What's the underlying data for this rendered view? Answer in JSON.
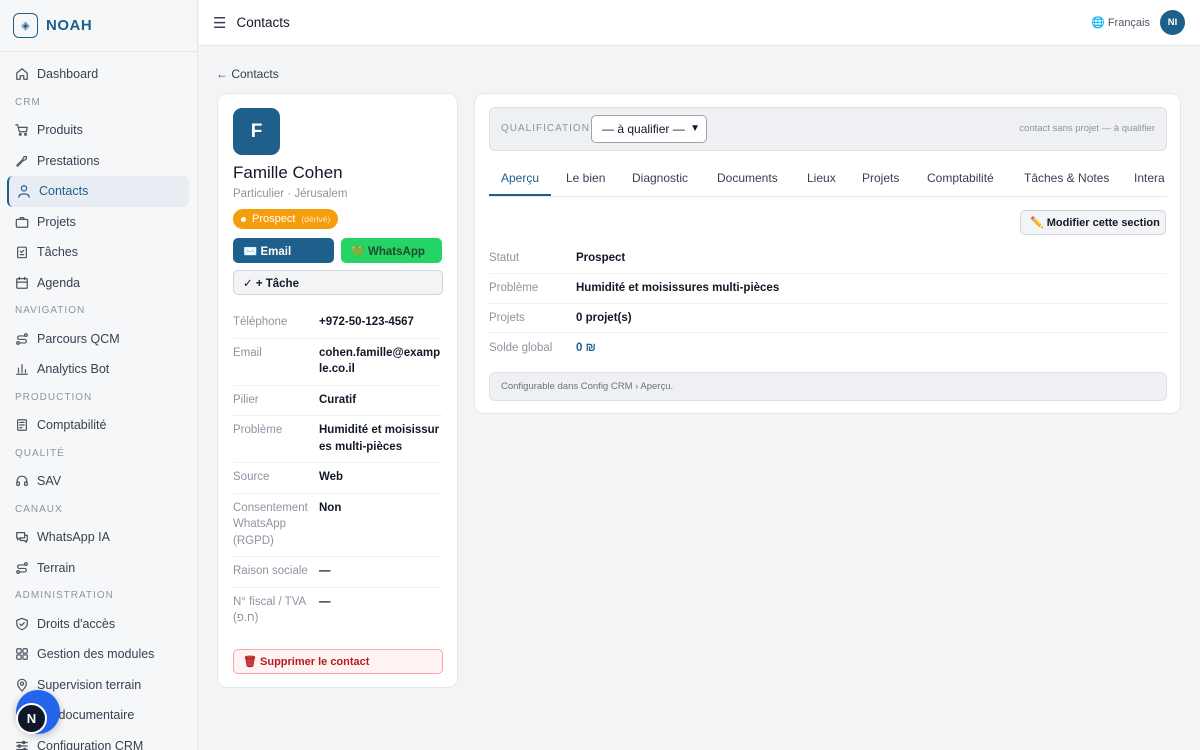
{
  "brand": {
    "name": "NOAH",
    "icon": "diamond-logo-icon"
  },
  "sidebar": {
    "items": [
      {
        "type": "item",
        "label": "Dashboard",
        "icon": "home-icon",
        "name": "sidebar-item-dashboard"
      },
      {
        "type": "section",
        "label": "CRM"
      },
      {
        "type": "item",
        "label": "Produits",
        "icon": "cart-icon",
        "name": "sidebar-item-produits"
      },
      {
        "type": "item",
        "label": "Prestations",
        "icon": "wrench-icon",
        "name": "sidebar-item-prestations"
      },
      {
        "type": "item",
        "label": "Contacts",
        "icon": "user-icon",
        "name": "sidebar-item-contacts",
        "active": true
      },
      {
        "type": "item",
        "label": "Projets",
        "icon": "briefcase-icon",
        "name": "sidebar-item-projets"
      },
      {
        "type": "item",
        "label": "Tâches",
        "icon": "clipboard-icon",
        "name": "sidebar-item-taches"
      },
      {
        "type": "item",
        "label": "Agenda",
        "icon": "calendar-icon",
        "name": "sidebar-item-agenda"
      },
      {
        "type": "section",
        "label": "NAVIGATION"
      },
      {
        "type": "item",
        "label": "Parcours QCM",
        "icon": "route-icon",
        "name": "sidebar-item-parcours-qcm"
      },
      {
        "type": "item",
        "label": "Analytics Bot",
        "icon": "bar-chart-icon",
        "name": "sidebar-item-analytics-bot"
      },
      {
        "type": "section",
        "label": "PRODUCTION"
      },
      {
        "type": "item",
        "label": "Comptabilité",
        "icon": "ledger-icon",
        "name": "sidebar-item-comptabilite"
      },
      {
        "type": "section",
        "label": "QUALITÉ"
      },
      {
        "type": "item",
        "label": "SAV",
        "icon": "headset-icon",
        "name": "sidebar-item-sav"
      },
      {
        "type": "section",
        "label": "CANAUX"
      },
      {
        "type": "item",
        "label": "WhatsApp IA",
        "icon": "chat-icon",
        "name": "sidebar-item-whatsapp-ia"
      },
      {
        "type": "item",
        "label": "Terrain",
        "icon": "route-icon",
        "name": "sidebar-item-terrain"
      },
      {
        "type": "section",
        "label": "ADMINISTRATION"
      },
      {
        "type": "item",
        "label": "Droits d'accès",
        "icon": "shield-icon",
        "name": "sidebar-item-droits-acces"
      },
      {
        "type": "item",
        "label": "Gestion des modules",
        "icon": "grid-icon",
        "name": "sidebar-item-gestion-modules"
      },
      {
        "type": "item",
        "label": "Supervision terrain",
        "icon": "map-pin-icon",
        "name": "sidebar-item-supervision-terrain"
      },
      {
        "type": "item",
        "label": "eur documentaire",
        "icon": "document-icon",
        "name": "sidebar-item-documentaire"
      },
      {
        "type": "item",
        "label": "Configuration CRM",
        "icon": "sliders-icon",
        "name": "sidebar-item-configuration-crm"
      }
    ]
  },
  "fab": {
    "label": "N"
  },
  "topbar": {
    "menu_icon": "hamburger-icon",
    "title": "Contacts",
    "language": "Français",
    "language_icon": "globe-icon",
    "avatar_initials": "NI"
  },
  "back_link": "← Contacts",
  "contact": {
    "initial": "F",
    "name": "Famille Cohen",
    "subtitle": "Particulier · Jérusalem",
    "status": "Prospect",
    "status_sub": "(dérivé)",
    "status_color": "#f59e0b",
    "email_button": "✉️ Email",
    "whatsapp_button": "💚 WhatsApp",
    "task_button": "✓ + Tâche",
    "delete_button": "🗑 Supprimer le contact",
    "fields": [
      {
        "label": "Téléphone",
        "value": "+972-50-123-4567"
      },
      {
        "label": "Email",
        "value": "cohen.famille@example.co.il"
      },
      {
        "label": "Pilier",
        "value": "Curatif"
      },
      {
        "label": "Problème",
        "value": "Humidité et moisissures multi-pièces"
      },
      {
        "label": "Source",
        "value": "Web"
      },
      {
        "label": "Consentement WhatsApp (RGPD)",
        "value": "Non"
      },
      {
        "label": "Raison sociale",
        "value": "—"
      },
      {
        "label": "N° fiscal / TVA (ח.פ)",
        "value": "—"
      }
    ]
  },
  "qualification": {
    "label": "QUALIFICATION",
    "selected": "— à qualifier —",
    "note": "contact sans projet — à qualifier"
  },
  "tabs": [
    "Aperçu",
    "Le bien",
    "Diagnostic",
    "Documents",
    "Lieux",
    "Projets",
    "Comptabilité",
    "Tâches & Notes",
    "Intera"
  ],
  "active_tab": "Aperçu",
  "edit_button": "✏️ Modifier cette section",
  "overview": [
    {
      "label": "Statut",
      "value": "Prospect"
    },
    {
      "label": "Problème",
      "value": "Humidité et moisissures multi-pièces"
    },
    {
      "label": "Projets",
      "value": "0 projet(s)"
    },
    {
      "label": "Solde global",
      "value": "0 ₪"
    }
  ],
  "config_note": "Configurable dans Config CRM › Aperçu.",
  "colors": {
    "primary": "#1e5f8c",
    "whatsapp": "#25d366",
    "danger": "#b91c1c",
    "warning": "#f59e0b"
  }
}
